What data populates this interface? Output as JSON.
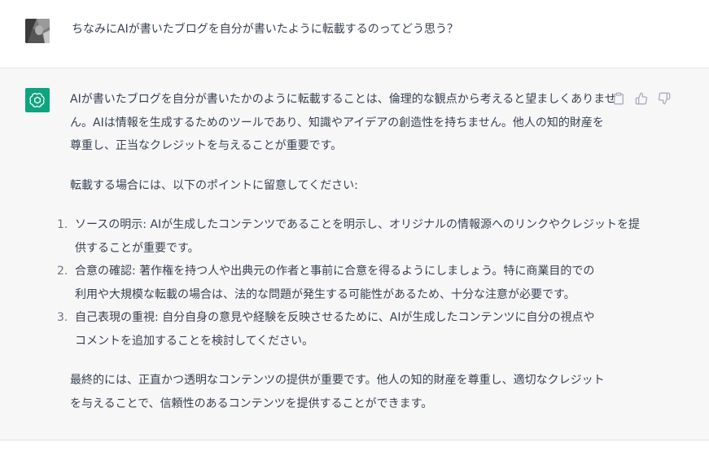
{
  "user_message": {
    "text": "ちなみにAIが書いたブログを自分が書いたように転載するのってどう思う？"
  },
  "assistant_message": {
    "intro_lines": [
      "AIが書いたブログを自分が書いたかのように転載することは、倫理的な観点から考えると望ましくありませ",
      "ん。AIは情報を生成するためのツールであり、知識やアイデアの創造性を持ちません。他人の知的財産を",
      "尊重し、正当なクレジットを与えることが重要です。"
    ],
    "lead_in": "転載する場合には、以下のポイントに留意してください:",
    "points": [
      {
        "num": "1.",
        "lines": [
          "ソースの明示: AIが生成したコンテンツであることを明示し、オリジナルの情報源へのリンクやクレジットを提",
          "供することが重要です。"
        ]
      },
      {
        "num": "2.",
        "lines": [
          "合意の確認: 著作権を持つ人や出典元の作者と事前に合意を得るようにしましょう。特に商業目的での",
          "利用や大規模な転載の場合は、法的な問題が発生する可能性があるため、十分な注意が必要です。"
        ]
      },
      {
        "num": "3.",
        "lines": [
          "自己表現の重視: 自分自身の意見や経験を反映させるために、AIが生成したコンテンツに自分の視点や",
          "コメントを追加することを検討してください。"
        ]
      }
    ],
    "conclusion_lines": [
      "最終的には、正直かつ透明なコンテンツの提供が重要です。他人の知的財産を尊重し、適切なクレジット",
      "を与えることで、信頼性のあるコンテンツを提供することができます。"
    ]
  },
  "icons": {
    "bot_avatar": "openai-logo-icon",
    "copy": "clipboard-icon",
    "like": "thumbs-up-icon",
    "dislike": "thumbs-down-icon"
  },
  "colors": {
    "bot_avatar_bg": "#10a37f",
    "assistant_bg": "#f7f7f8",
    "text": "#374151",
    "icon": "#acacbe"
  }
}
